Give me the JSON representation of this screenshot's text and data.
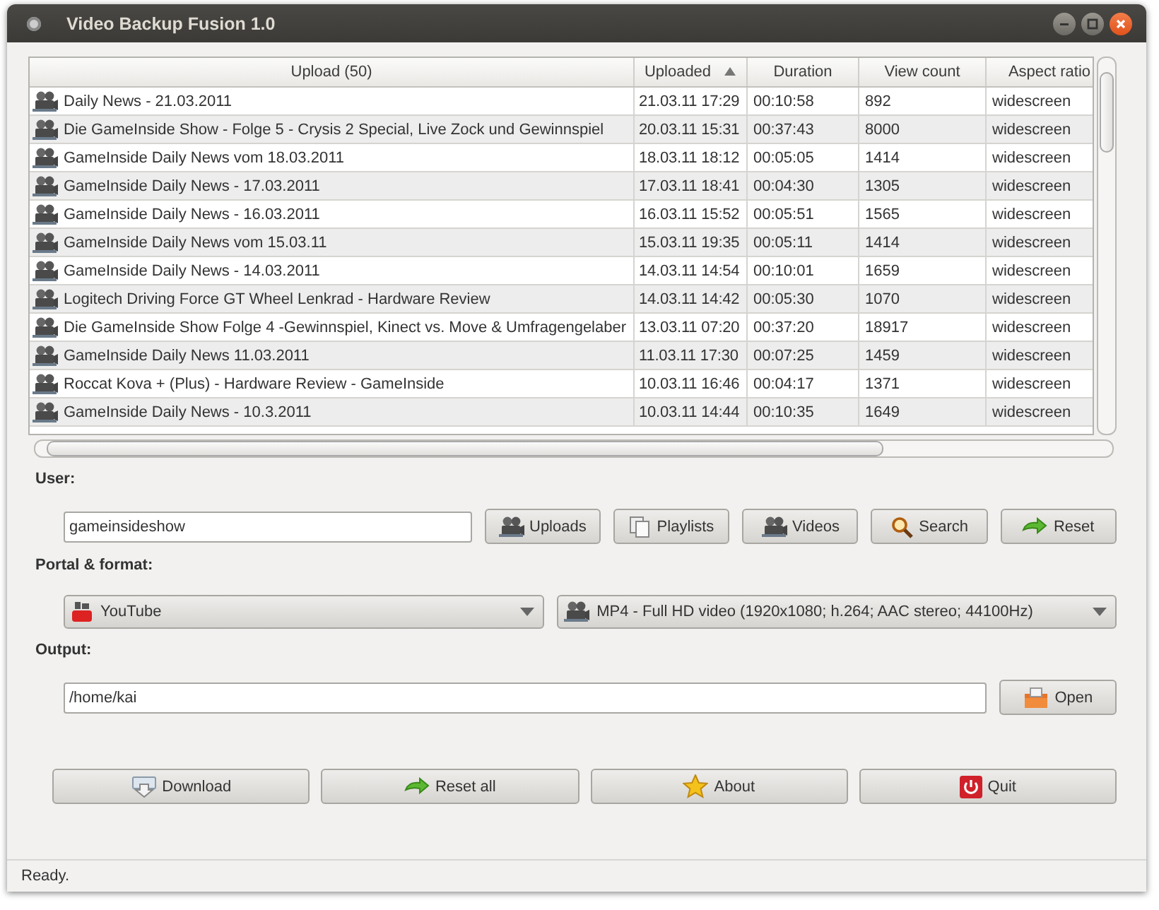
{
  "window": {
    "title": "Video Backup Fusion 1.0"
  },
  "table": {
    "columns": [
      {
        "label": "Upload (50)",
        "sorted": false
      },
      {
        "label": "Uploaded",
        "sorted": true
      },
      {
        "label": "Duration",
        "sorted": false
      },
      {
        "label": "View count",
        "sorted": false
      },
      {
        "label": "Aspect ratio",
        "sorted": false
      }
    ],
    "rows": [
      [
        "Daily News - 21.03.2011",
        "21.03.11 17:29",
        "00:10:58",
        "892",
        "widescreen"
      ],
      [
        "Die GameInside Show - Folge 5 - Crysis 2 Special, Live Zock und Gewinnspiel",
        "20.03.11 15:31",
        "00:37:43",
        "8000",
        "widescreen"
      ],
      [
        "GameInside Daily News vom 18.03.2011",
        "18.03.11 18:12",
        "00:05:05",
        "1414",
        "widescreen"
      ],
      [
        "GameInside Daily News - 17.03.2011",
        "17.03.11 18:41",
        "00:04:30",
        "1305",
        "widescreen"
      ],
      [
        "GameInside Daily News - 16.03.2011",
        "16.03.11 15:52",
        "00:05:51",
        "1565",
        "widescreen"
      ],
      [
        "GameInside Daily News vom 15.03.11",
        "15.03.11 19:35",
        "00:05:11",
        "1414",
        "widescreen"
      ],
      [
        "GameInside Daily News - 14.03.2011",
        "14.03.11 14:54",
        "00:10:01",
        "1659",
        "widescreen"
      ],
      [
        "Logitech Driving Force GT Wheel Lenkrad - Hardware Review",
        "14.03.11 14:42",
        "00:05:30",
        "1070",
        "widescreen"
      ],
      [
        "Die GameInside Show Folge 4 -Gewinnspiel, Kinect vs. Move & Umfragengelaber",
        "13.03.11 07:20",
        "00:37:20",
        "18917",
        "widescreen"
      ],
      [
        "GameInside Daily News 11.03.2011",
        "11.03.11 17:30",
        "00:07:25",
        "1459",
        "widescreen"
      ],
      [
        "Roccat Kova + (Plus) - Hardware Review - GameInside",
        "10.03.11 16:46",
        "00:04:17",
        "1371",
        "widescreen"
      ],
      [
        "GameInside Daily News - 10.3.2011",
        "10.03.11 14:44",
        "00:10:35",
        "1649",
        "widescreen"
      ]
    ]
  },
  "user": {
    "label": "User:",
    "value": "gameinsideshow",
    "buttons": [
      "Uploads",
      "Playlists",
      "Videos",
      "Search",
      "Reset"
    ]
  },
  "portal": {
    "label": "Portal & format:",
    "portal": "YouTube",
    "format": "MP4 - Full HD video (1920x1080; h.264; AAC stereo; 44100Hz)"
  },
  "output": {
    "label": "Output:",
    "value": "/home/kai",
    "button": "Open"
  },
  "actions": [
    "Download",
    "Reset all",
    "About",
    "Quit"
  ],
  "status_bar": "Ready."
}
